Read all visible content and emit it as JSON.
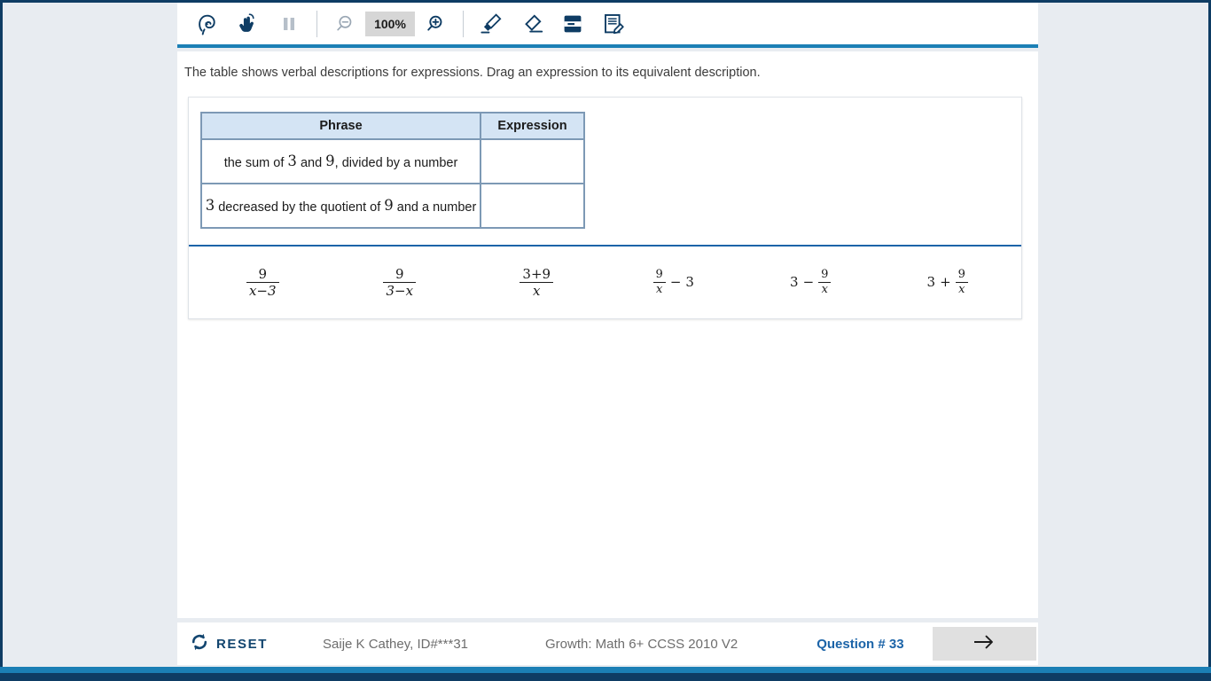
{
  "toolbar": {
    "tools": [
      {
        "name": "listen-icon",
        "label": "Listen",
        "disabled": false
      },
      {
        "name": "pointer-hand-icon",
        "label": "Pointer",
        "disabled": false
      },
      {
        "name": "pause-icon",
        "label": "Pause",
        "disabled": true
      },
      {
        "name": "zoom-out-icon",
        "label": "Zoom Out",
        "disabled": true
      },
      {
        "name": "zoom-in-icon",
        "label": "Zoom In",
        "disabled": false
      },
      {
        "name": "highlighter-icon",
        "label": "Highlighter",
        "disabled": false
      },
      {
        "name": "eraser-icon",
        "label": "Eraser",
        "disabled": false
      },
      {
        "name": "line-reader-icon",
        "label": "Line Reader",
        "disabled": false
      },
      {
        "name": "notepad-icon",
        "label": "Notepad",
        "disabled": false
      }
    ],
    "zoom_level": "100%"
  },
  "question": {
    "stem": "The table shows verbal descriptions for expressions. Drag an expression to its equivalent description."
  },
  "table": {
    "headers": {
      "phrase": "Phrase",
      "expression": "Expression"
    },
    "rows": [
      {
        "phrase_parts": [
          {
            "text": "the sum of ",
            "style": "text"
          },
          {
            "text": "3",
            "style": "math"
          },
          {
            "text": " and ",
            "style": "text"
          },
          {
            "text": "9",
            "style": "math"
          },
          {
            "text": ", divided by a number",
            "style": "text"
          }
        ],
        "phrase_plain": "the sum of 3 and 9, divided by a number",
        "answer": ""
      },
      {
        "phrase_parts": [
          {
            "text": "3",
            "style": "math"
          },
          {
            "text": " decreased by the quotient of ",
            "style": "text"
          },
          {
            "text": "9",
            "style": "math"
          },
          {
            "text": " and a number",
            "style": "text"
          }
        ],
        "phrase_plain": "3 decreased by the quotient of 9 and a number",
        "answer": ""
      }
    ]
  },
  "expression_bank": {
    "items": [
      {
        "id": "expr-1",
        "latex": "9/(x-3)",
        "plain": "9 over x minus 3",
        "numerator": "9",
        "denominator": "x−3",
        "kind": "fraction"
      },
      {
        "id": "expr-2",
        "latex": "9/(3-x)",
        "plain": "9 over 3 minus x",
        "numerator": "9",
        "denominator": "3−x",
        "kind": "fraction"
      },
      {
        "id": "expr-3",
        "latex": "(3+9)/x",
        "plain": "3 plus 9 over x",
        "numerator": "3+9",
        "denominator": "x",
        "kind": "fraction"
      },
      {
        "id": "expr-4",
        "latex": "9/x - 3",
        "plain": "9 over x minus 3",
        "numerator": "9",
        "denominator": "x",
        "operator": "−",
        "trailing": "3",
        "kind": "frac-then-term"
      },
      {
        "id": "expr-5",
        "latex": "3 - 9/x",
        "plain": "3 minus 9 over x",
        "leading": "3",
        "operator": "−",
        "numerator": "9",
        "denominator": "x",
        "kind": "term-then-frac"
      },
      {
        "id": "expr-6",
        "latex": "3 + 9/x",
        "plain": "3 plus 9 over x",
        "leading": "3",
        "operator": "+",
        "numerator": "9",
        "denominator": "x",
        "kind": "term-then-frac"
      }
    ]
  },
  "footer": {
    "reset_label": "RESET",
    "student_info": "Saije K Cathey, ID#***31",
    "test_name": "Growth: Math 6+ CCSS 2010 V2",
    "question_number": "Question # 33",
    "next_label": "Next"
  },
  "colors": {
    "frame_dark_blue": "#0e3c64",
    "accent_blue": "#1b7fb5",
    "link_blue": "#1c64a8",
    "table_header_fill": "#d4e4f4",
    "table_border": "#7d99b5",
    "page_bg": "#e8ecf1"
  }
}
